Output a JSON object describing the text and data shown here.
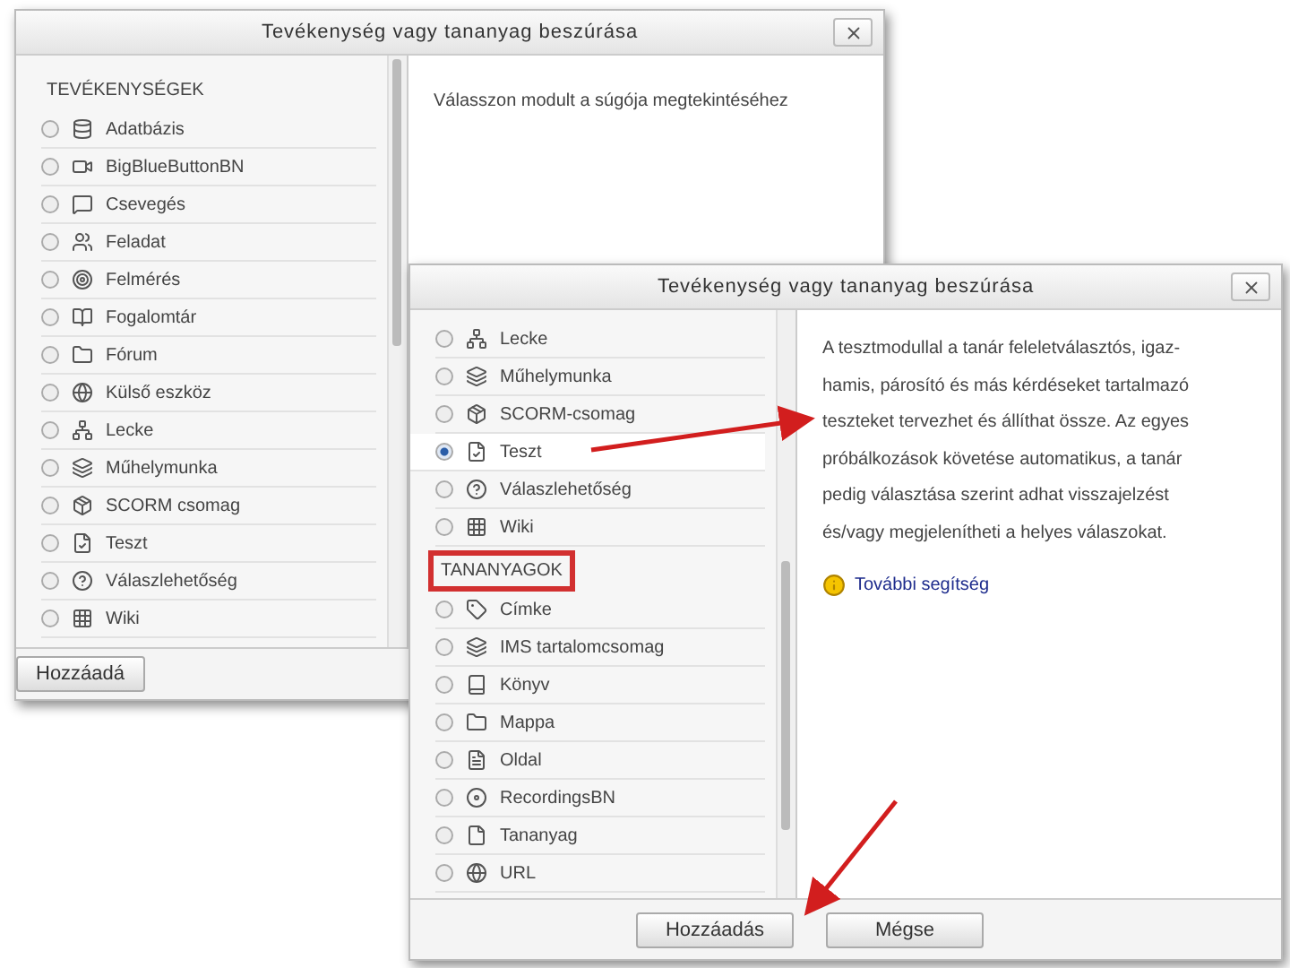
{
  "dialogs": [
    {
      "title": "Tevékenység vagy tananyag beszúrása",
      "sections": [
        {
          "heading": "TEVÉKENYSÉGEK",
          "highlighted": false,
          "items": [
            {
              "label": "Adatbázis",
              "selected": false
            },
            {
              "label": "BigBlueButtonBN",
              "selected": false
            },
            {
              "label": "Csevegés",
              "selected": false
            },
            {
              "label": "Feladat",
              "selected": false
            },
            {
              "label": "Felmérés",
              "selected": false
            },
            {
              "label": "Fogalomtár",
              "selected": false
            },
            {
              "label": "Fórum",
              "selected": false
            },
            {
              "label": "Külső eszköz",
              "selected": false
            },
            {
              "label": "Lecke",
              "selected": false
            },
            {
              "label": "Műhelymunka",
              "selected": false
            },
            {
              "label": "SCORM csomag",
              "selected": false
            },
            {
              "label": "Teszt",
              "selected": false
            },
            {
              "label": "Válaszlehetőség",
              "selected": false
            },
            {
              "label": "Wiki",
              "selected": false
            }
          ]
        }
      ],
      "help_text": "Válasszon modult a súgója megtekintéséhez",
      "buttons": [
        "Hozzáadá"
      ]
    },
    {
      "title": "Tevékenység vagy tananyag beszúrása",
      "sections": [
        {
          "items": [
            {
              "label": "Lecke",
              "selected": false
            },
            {
              "label": "Műhelymunka",
              "selected": false
            },
            {
              "label": "SCORM-csomag",
              "selected": false
            },
            {
              "label": "Teszt",
              "selected": true
            },
            {
              "label": "Válaszlehetőség",
              "selected": false
            },
            {
              "label": "Wiki",
              "selected": false
            }
          ]
        },
        {
          "heading": "TANANYAGOK",
          "highlighted": true,
          "items": [
            {
              "label": "Címke",
              "selected": false
            },
            {
              "label": "IMS tartalomcsomag",
              "selected": false
            },
            {
              "label": "Könyv",
              "selected": false
            },
            {
              "label": "Mappa",
              "selected": false
            },
            {
              "label": "Oldal",
              "selected": false
            },
            {
              "label": "RecordingsBN",
              "selected": false
            },
            {
              "label": "Tananyag",
              "selected": false
            },
            {
              "label": "URL",
              "selected": false
            }
          ]
        }
      ],
      "help_text": "A tesztmodullal a tanár feleletválasztós, igaz-hamis, párosító és más kérdéseket tartalmazó teszteket tervezhet és állíthat össze. Az egyes próbálkozások követése automatikus, a tanár pedig választása szerint adhat visszajelzést és/vagy megjelenítheti a helyes válaszokat.",
      "help_link": "További segítség",
      "buttons": [
        "Hozzáadás",
        "Mégse"
      ]
    }
  ]
}
